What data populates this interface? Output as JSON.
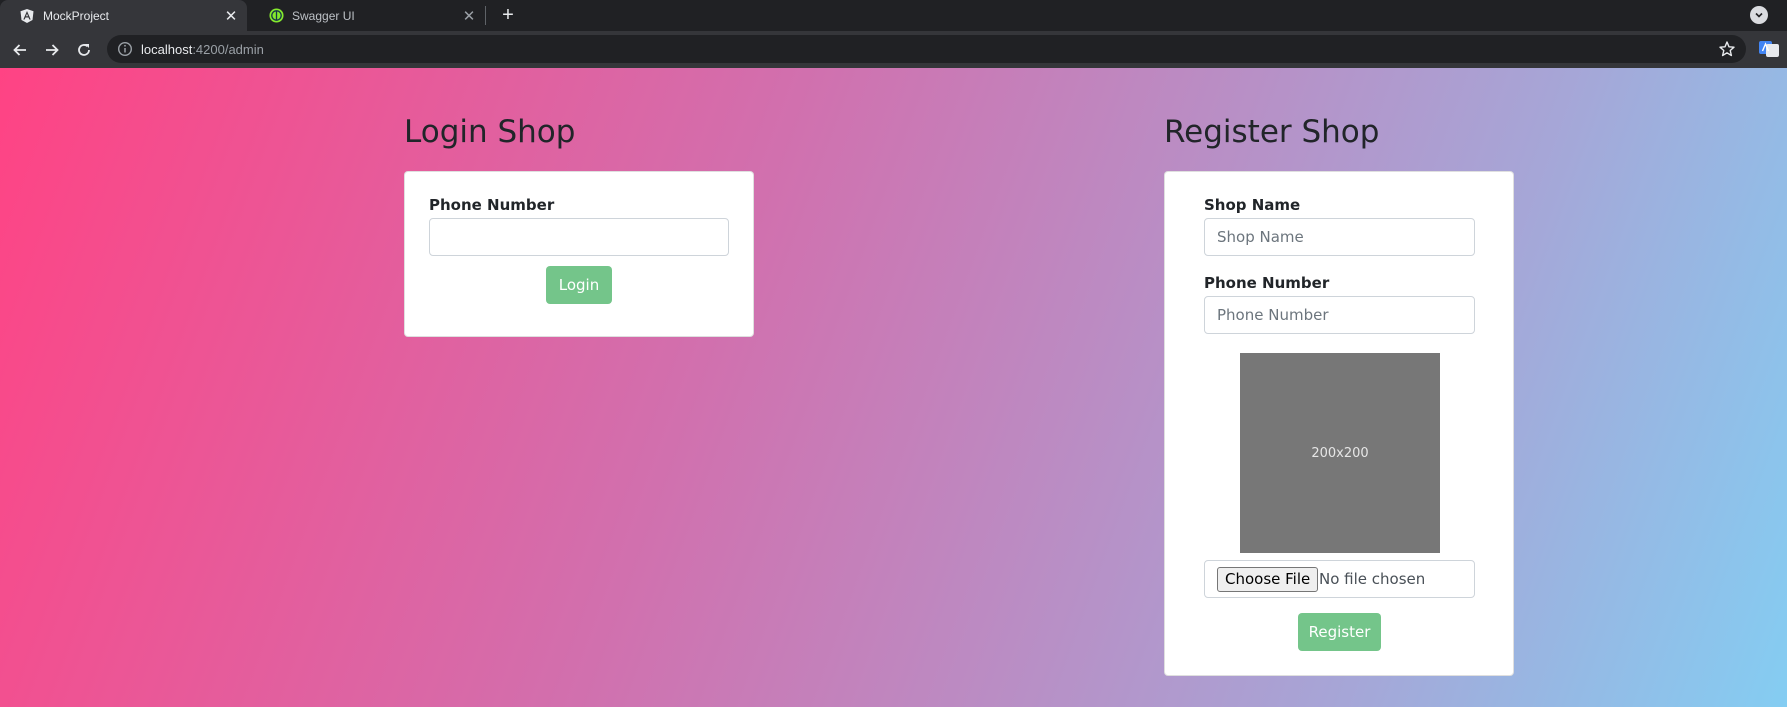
{
  "browser": {
    "tabs": [
      {
        "title": "MockProject",
        "favicon": "angular-icon",
        "active": true
      },
      {
        "title": "Swagger UI",
        "favicon": "swagger-icon",
        "active": false
      }
    ],
    "address": {
      "host": "localhost",
      "path": ":4200/admin"
    }
  },
  "login": {
    "heading": "Login Shop",
    "phone_label": "Phone Number",
    "phone_value": "",
    "button_label": "Login"
  },
  "register": {
    "heading": "Register Shop",
    "shop_name_label": "Shop Name",
    "shop_name_placeholder": "Shop Name",
    "phone_label": "Phone Number",
    "phone_placeholder": "Phone Number",
    "image_placeholder_text": "200x200",
    "choose_file_label": "Choose File",
    "file_status": "No file chosen",
    "button_label": "Register"
  },
  "colors": {
    "success": "#74c58a",
    "placeholder_image": "#777777",
    "gradient": [
      "#ff4384",
      "#d170ae",
      "#a6a6d7",
      "#84cdf2"
    ]
  }
}
